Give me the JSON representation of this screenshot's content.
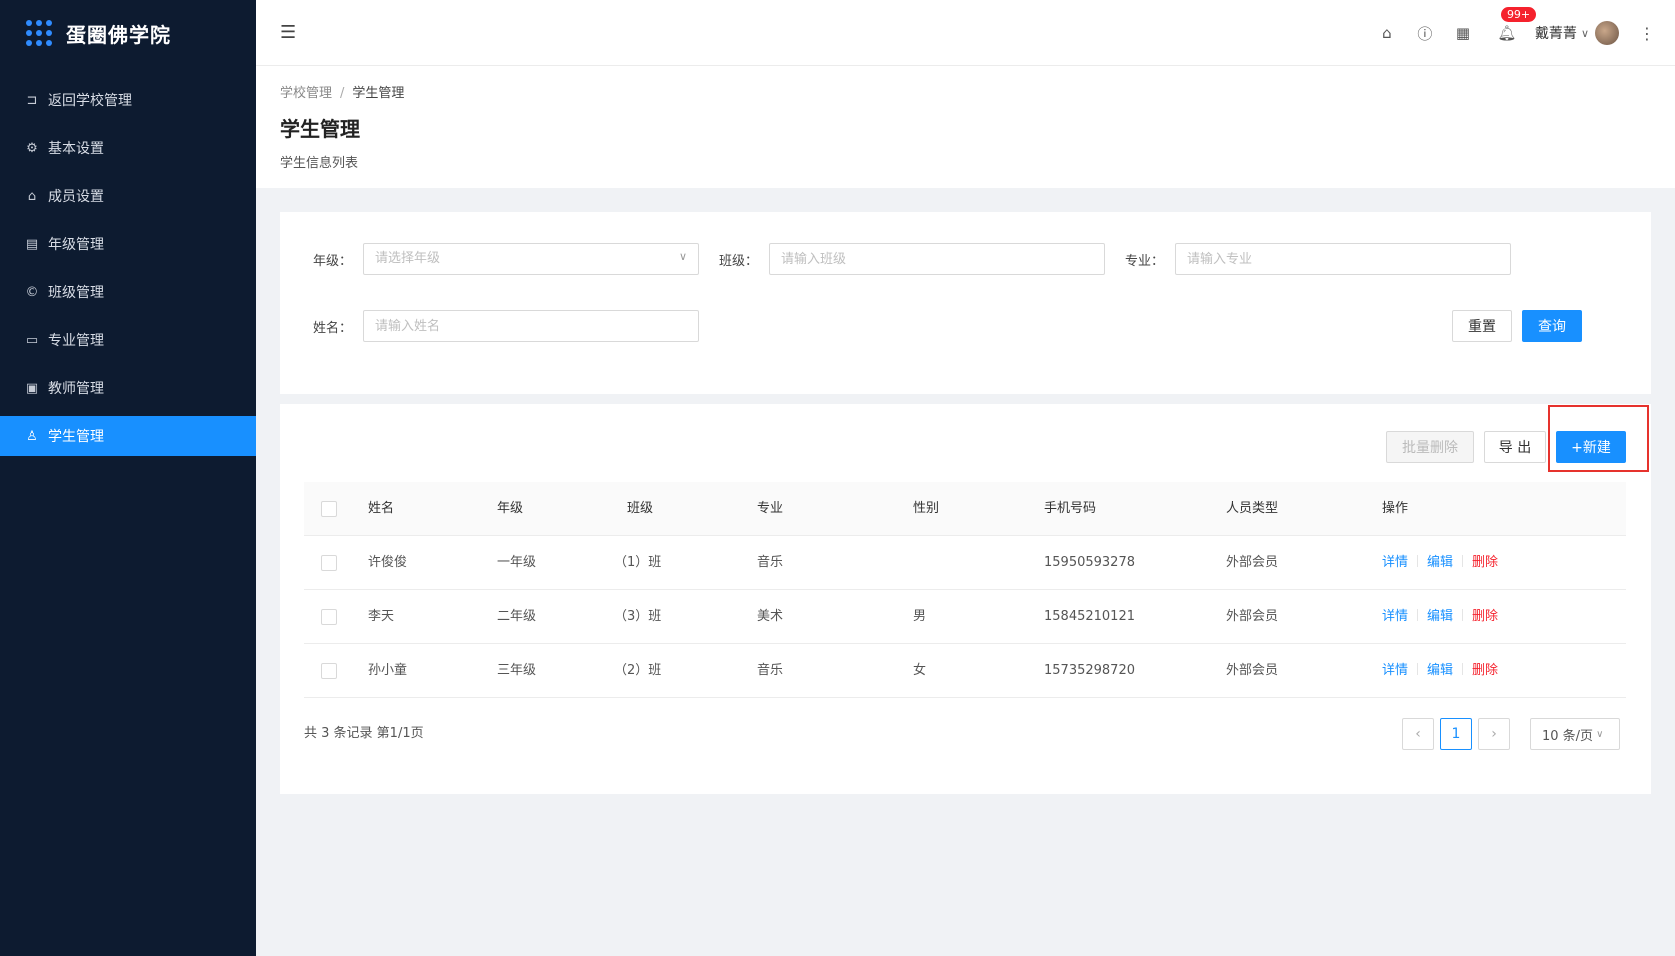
{
  "app": {
    "title": "蛋圈佛学院",
    "accent": "#1890ff"
  },
  "sidebar": {
    "items": [
      {
        "label": "返回学校管理",
        "icon": "return-icon",
        "glyph": "⊐"
      },
      {
        "label": "基本设置",
        "icon": "gear-icon",
        "glyph": "⚙"
      },
      {
        "label": "成员设置",
        "icon": "home-icon",
        "glyph": "⌂"
      },
      {
        "label": "年级管理",
        "icon": "building-icon",
        "glyph": "▤"
      },
      {
        "label": "班级管理",
        "icon": "copyright-icon",
        "glyph": "©"
      },
      {
        "label": "专业管理",
        "icon": "laptop-icon",
        "glyph": "▭"
      },
      {
        "label": "教师管理",
        "icon": "id-card-icon",
        "glyph": "▣"
      },
      {
        "label": "学生管理",
        "icon": "user-icon",
        "glyph": "♙",
        "active": true
      }
    ]
  },
  "header": {
    "notification_count": "99+",
    "username": "戴菁菁"
  },
  "breadcrumb": {
    "parent": "学校管理",
    "separator": "/",
    "current": "学生管理"
  },
  "page": {
    "title": "学生管理",
    "subtitle": "学生信息列表"
  },
  "filters": {
    "grade_label": "年级：",
    "grade_placeholder": "请选择年级",
    "class_label": "班级：",
    "class_placeholder": "请输入班级",
    "major_label": "专业：",
    "major_placeholder": "请输入专业",
    "name_label": "姓名：",
    "name_placeholder": "请输入姓名",
    "reset_label": "重置",
    "query_label": "查询"
  },
  "toolbar": {
    "batch_delete_label": "批量删除",
    "export_label": "导 出",
    "new_label": "+新建"
  },
  "table": {
    "columns": [
      "姓名",
      "年级",
      "班级",
      "专业",
      "性别",
      "手机号码",
      "人员类型",
      "操作"
    ],
    "rows": [
      {
        "name": "许俊俊",
        "grade": "一年级",
        "class": "（1）班",
        "major": "音乐",
        "gender": "",
        "phone": "15950593278",
        "type": "外部会员"
      },
      {
        "name": "李天",
        "grade": "二年级",
        "class": "（3）班",
        "major": "美术",
        "gender": "男",
        "phone": "15845210121",
        "type": "外部会员"
      },
      {
        "name": "孙小童",
        "grade": "三年级",
        "class": "（2）班",
        "major": "音乐",
        "gender": "女",
        "phone": "15735298720",
        "type": "外部会员"
      }
    ],
    "actions": {
      "detail": "详情",
      "edit": "编辑",
      "delete": "删除"
    }
  },
  "pagination": {
    "summary": "共 3 条记录 第1/1页",
    "current_page": "1",
    "page_size": "10 条/页"
  }
}
